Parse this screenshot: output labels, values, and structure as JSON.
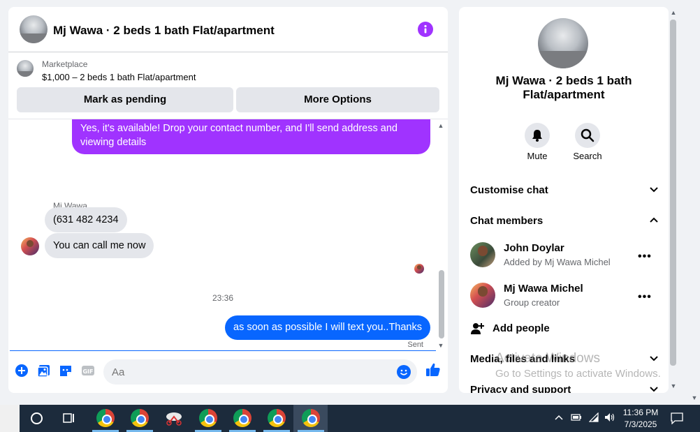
{
  "chat": {
    "title": "Mj Wawa · 2 beds 1 bath Flat/apartment",
    "marketplace_label": "Marketplace",
    "listing": "$1,000 – 2 beds 1 bath Flat/apartment",
    "mark_pending_label": "Mark as pending",
    "more_options_label": "More Options",
    "messages": {
      "outgoing_purple": "Yes, it's available! Drop your contact number, and I'll send address and viewing details",
      "sender_name": "Mj Wawa",
      "incoming_1": "(631 482 4234",
      "incoming_2": "You can call me now",
      "timestamp": "23:36",
      "outgoing_blue": "as soon as possible I will text you..Thanks",
      "status": "Sent"
    },
    "composer": {
      "placeholder": "Aa"
    },
    "colors": {
      "accent_purple": "#a033ff",
      "accent_blue": "#0866ff"
    }
  },
  "side": {
    "title": "Mj Wawa · 2 beds 1 bath Flat/apartment",
    "mute_label": "Mute",
    "search_label": "Search",
    "customise_label": "Customise chat",
    "members_label": "Chat members",
    "members": [
      {
        "name": "John Doylar",
        "sub": "Added by Mj Wawa Michel"
      },
      {
        "name": "Mj Wawa Michel",
        "sub": "Group creator"
      }
    ],
    "add_people_label": "Add people",
    "media_label": "Media, files and links",
    "privacy_label": "Privacy and support"
  },
  "watermark": {
    "line1": "Activate Windows",
    "line2": "Go to Settings to activate Windows."
  },
  "taskbar": {
    "time": "11:36 PM",
    "date": "7/3/2025"
  }
}
